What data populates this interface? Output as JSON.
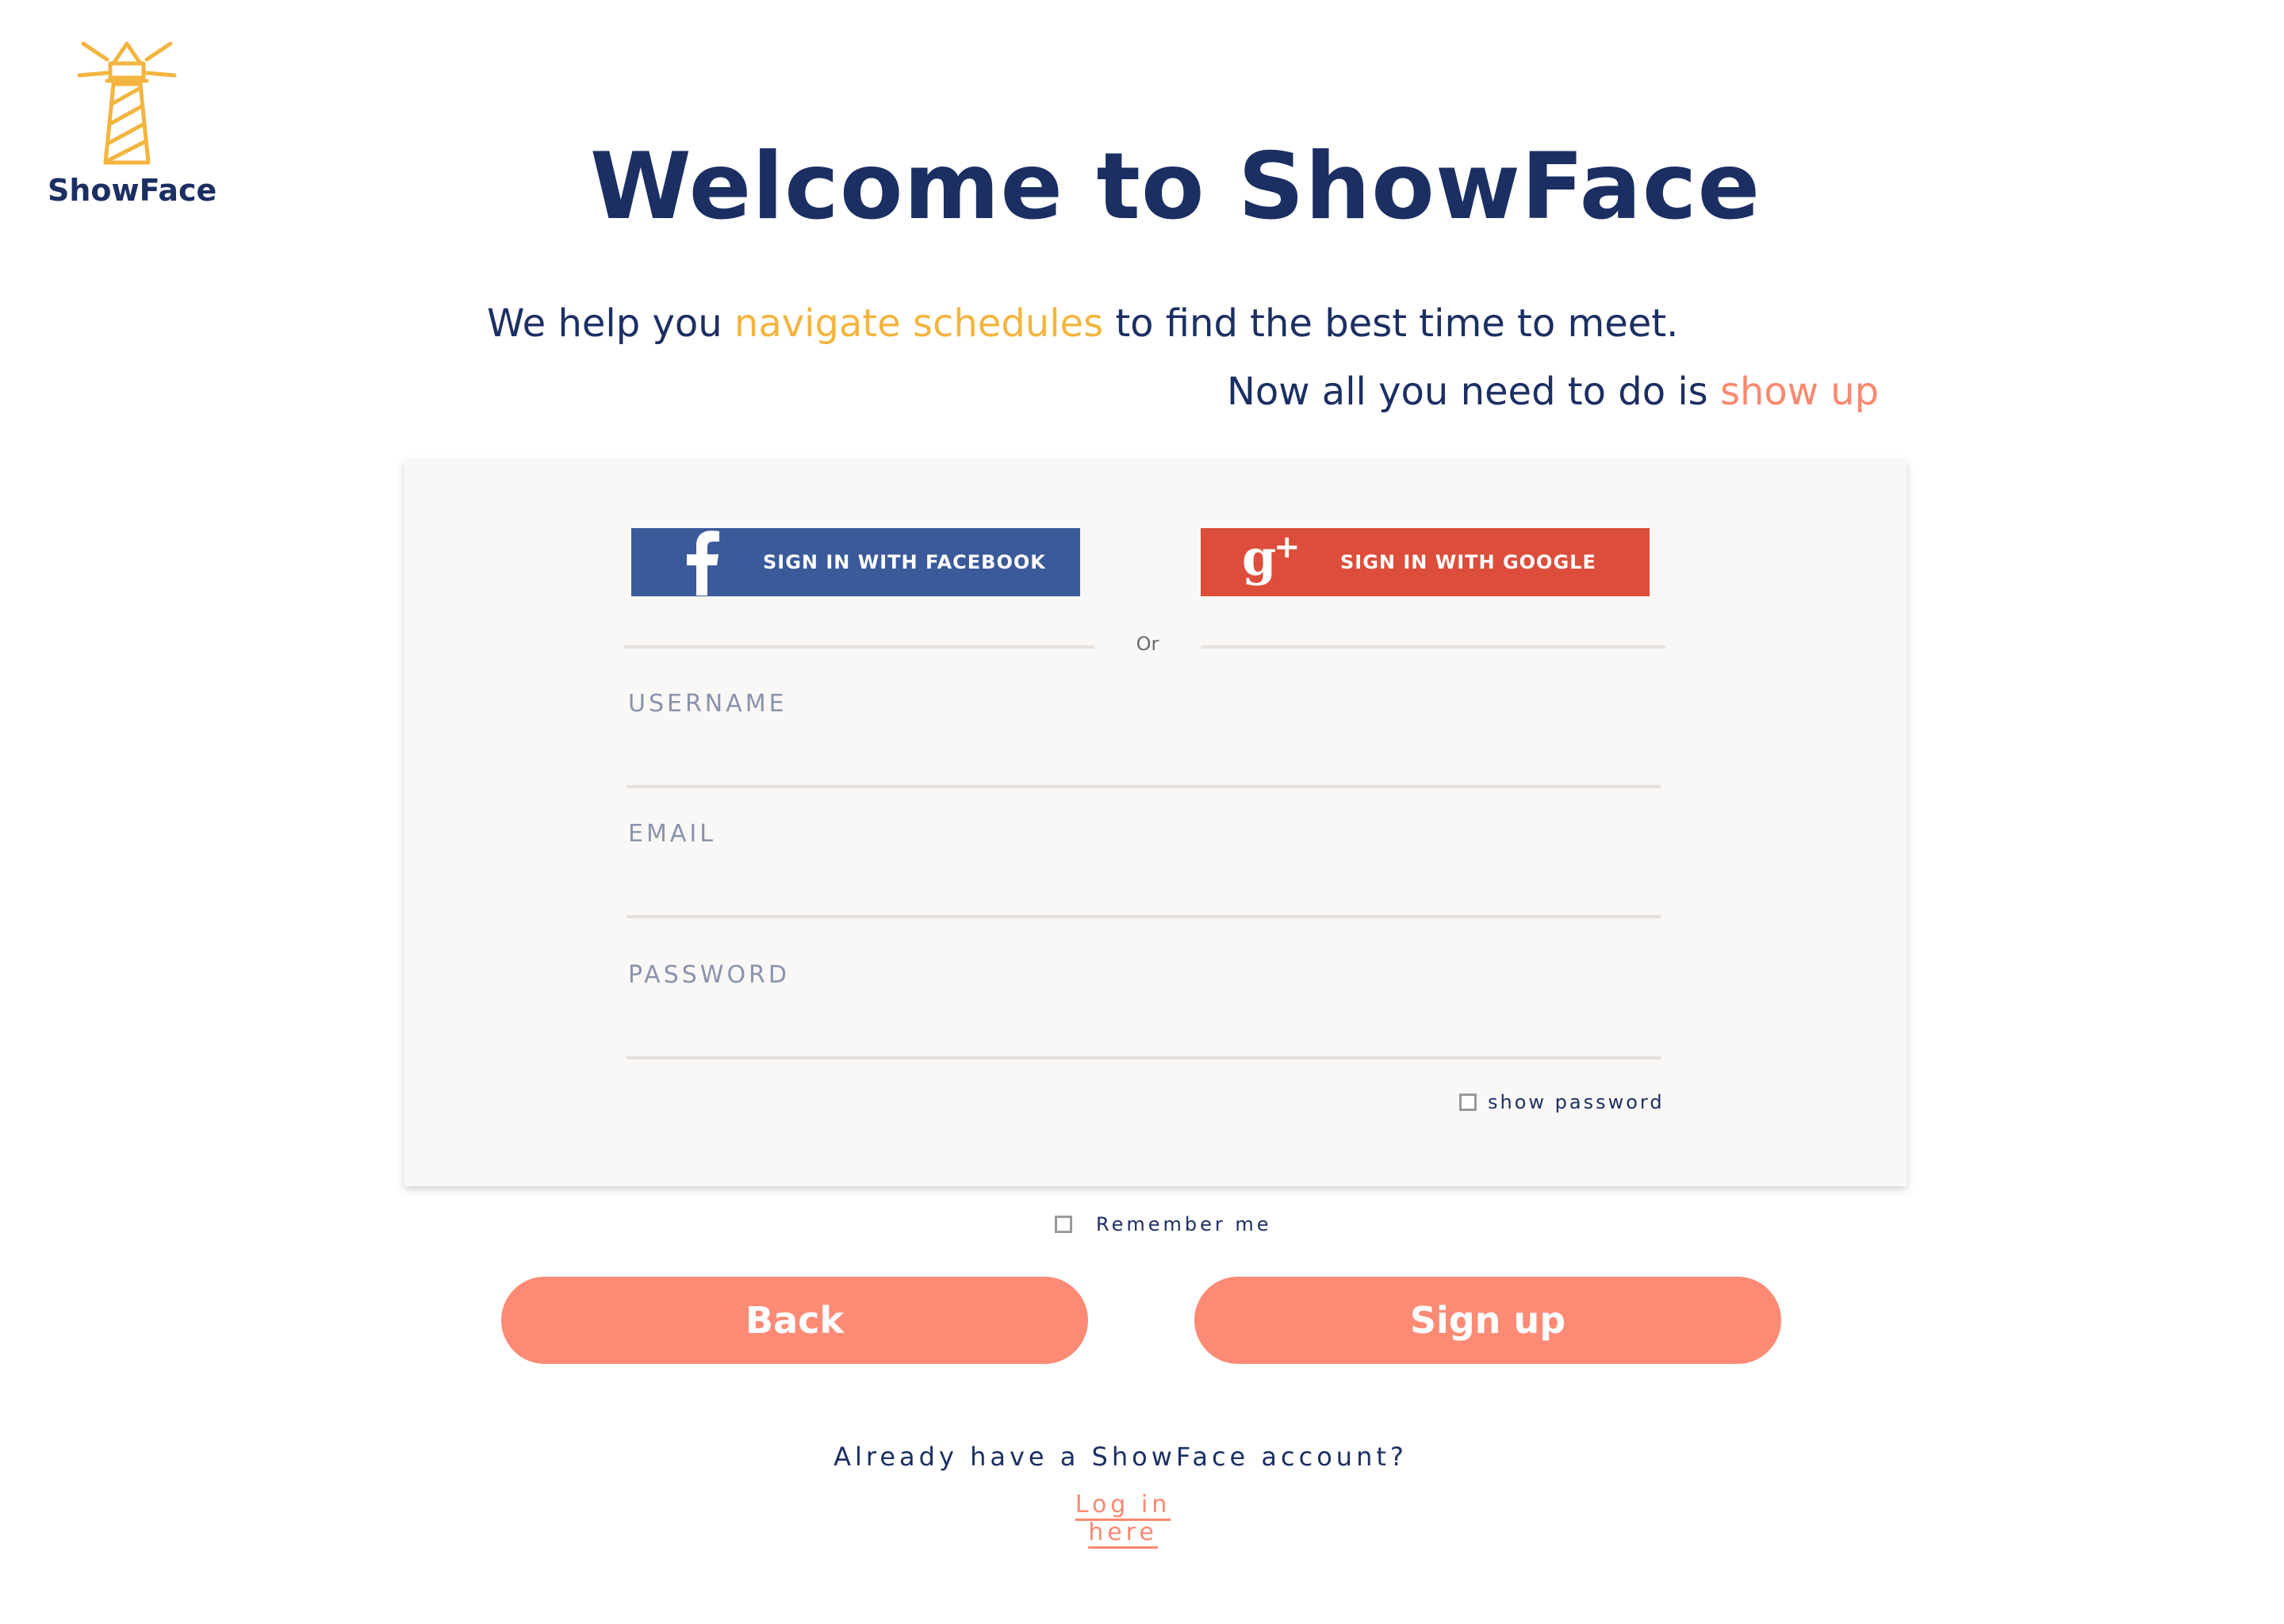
{
  "brand": {
    "name": "ShowFace",
    "logo_icon": "lighthouse-icon",
    "logo_color": "#f3b53f",
    "text_color": "#1c2f63"
  },
  "hero": {
    "title": "Welcome to ShowFace",
    "line1": {
      "before": "We help you ",
      "highlight": "navigate schedules",
      "after": " to find the best time to meet."
    },
    "line2": {
      "before": "Now all you need to do is ",
      "highlight": "show up"
    },
    "highlight_colors": {
      "yellow": "#f3b53f",
      "coral": "#fb8870"
    }
  },
  "social": {
    "facebook": {
      "label": "SIGN IN WITH FACEBOOK",
      "icon": "facebook-icon",
      "color": "#3b5a9a"
    },
    "google": {
      "label": "SIGN IN WITH GOOGLE",
      "icon": "google-plus-icon",
      "color": "#dc4e3b"
    },
    "divider_text": "Or"
  },
  "form": {
    "username_label": "USERNAME",
    "username_value": "",
    "email_label": "EMAIL",
    "email_value": "",
    "password_label": "PASSWORD",
    "password_value": "",
    "show_password_label": "show password",
    "show_password_checked": false,
    "remember_me_label": "Remember me",
    "remember_me_checked": false
  },
  "actions": {
    "back_label": "Back",
    "signup_label": "Sign up",
    "button_color": "#fd8a75"
  },
  "footer": {
    "already_text": "Already have a ShowFace account?",
    "login_link_text": "Log in here"
  }
}
